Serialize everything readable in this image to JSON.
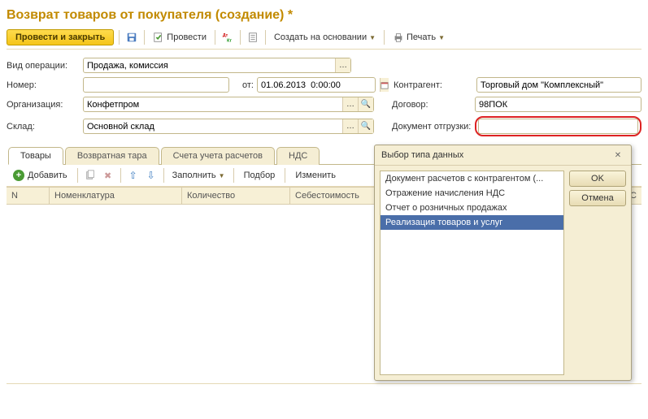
{
  "title": "Возврат товаров от покупателя (создание) *",
  "toolbar": {
    "main_btn": "Провести и закрыть",
    "provesti": "Провести",
    "create_base": "Создать на основании",
    "print": "Печать"
  },
  "fields": {
    "operation_label": "Вид операции:",
    "operation_value": "Продажа, комиссия",
    "number_label": "Номер:",
    "number_value": "",
    "from_label": "от:",
    "date_value": "01.06.2013  0:00:00",
    "org_label": "Организация:",
    "org_value": "Конфетпром",
    "sklad_label": "Склад:",
    "sklad_value": "Основной склад",
    "contragent_label": "Контрагент:",
    "contragent_value": "Торговый дом \"Комплексный\"",
    "dogovor_label": "Договор:",
    "dogovor_value": "98ПОК",
    "docship_label": "Документ отгрузки:",
    "docship_value": ""
  },
  "tabs": [
    "Товары",
    "Возвратная тара",
    "Счета учета расчетов",
    "НДС"
  ],
  "tab_toolbar": {
    "add": "Добавить",
    "fill": "Заполнить",
    "podbor": "Подбор",
    "change": "Изменить"
  },
  "columns": {
    "n": "N",
    "nomen": "Номенклатура",
    "qty": "Количество",
    "cost": "Себестоимость",
    "nds": "ДС"
  },
  "dialog": {
    "title": "Выбор типа данных",
    "items": [
      "Документ расчетов с контрагентом (...",
      "Отражение начисления НДС",
      "Отчет о розничных продажах",
      "Реализация товаров и услуг"
    ],
    "selected": 3,
    "ok": "OK",
    "cancel": "Отмена"
  }
}
